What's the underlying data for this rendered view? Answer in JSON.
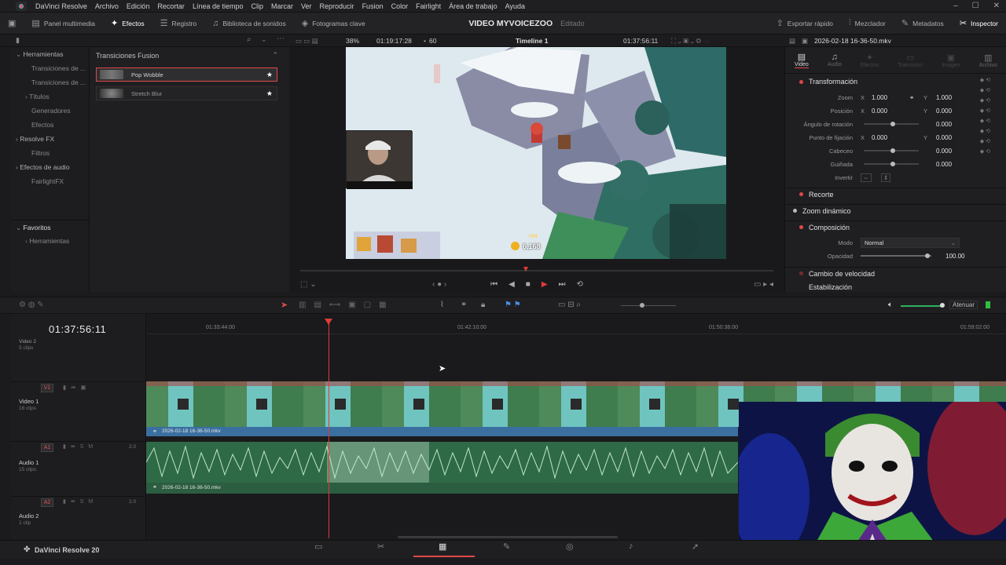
{
  "menu": {
    "app": "DaVinci Resolve",
    "items": [
      "Archivo",
      "Edición",
      "Recortar",
      "Línea de tiempo",
      "Clip",
      "Marcar",
      "Ver",
      "Reproducir",
      "Fusion",
      "Color",
      "Fairlight",
      "Área de trabajo",
      "Ayuda"
    ]
  },
  "toolbar": {
    "left": [
      "Panel multimedia",
      "Efectos",
      "Registro",
      "Biblioteca de sonidos",
      "Fotogramas clave"
    ],
    "project": "VIDEO MYVOICEZOO",
    "status": "Editado",
    "right": [
      "Exportar rápido",
      "Mezclador",
      "Metadatos",
      "Inspector"
    ]
  },
  "viewer": {
    "zoom": "38%",
    "timecode_left": "01:19:17:28",
    "fps_label": "60",
    "timeline_name": "Timeline 1",
    "timecode_right": "01:37:56:11",
    "clip_name": "2026-02-18 16-36-50.mkv",
    "coin_value": "6,168",
    "coin_bonus": "+54"
  },
  "leftnav": {
    "tools": "Herramientas",
    "items": [
      "Transiciones de ...",
      "Transiciones de ...",
      "Títulos",
      "Generadores",
      "Efectos"
    ],
    "resolvefx": "Resolve FX",
    "filtros": "Filtros",
    "audio_fx": "Efectos de audio",
    "fairlight": "FairlightFX",
    "favoritos": "Favoritos",
    "fav_tools": "Herramientas"
  },
  "effects": {
    "title": "Transiciones Fusion",
    "items": [
      {
        "label": "Pop Wobble"
      },
      {
        "label": "Stretch Blur"
      }
    ]
  },
  "inspector": {
    "tabs": [
      "Video",
      "Audio",
      "Efectos",
      "Transición",
      "Imagen",
      "Archivo"
    ],
    "transform": "Transformación",
    "zoom": "Zoom",
    "zoom_x": "1.000",
    "zoom_y": "1.000",
    "position": "Posición",
    "pos_x": "0.000",
    "pos_y": "0.000",
    "rotation": "Ángulo de rotación",
    "rotation_val": "0.000",
    "anchor": "Punto de fijación",
    "anchor_x": "0.000",
    "anchor_y": "0.000",
    "pitch": "Cabeceo",
    "pitch_val": "0.000",
    "yaw": "Guiñada",
    "yaw_val": "0.000",
    "flip": "Invertir",
    "crop": "Recorte",
    "dynzoom": "Zoom dinámico",
    "comp": "Composición",
    "mode": "Modo",
    "mode_val": "Normal",
    "opacity": "Opacidad",
    "opacity_val": "100.00",
    "speed": "Cambio de velocidad",
    "stab": "Estabilización"
  },
  "timeline": {
    "timecode": "01:37:56:11",
    "ruler": [
      "01:33:44:00",
      "01:42:10:00",
      "01:50:36:00",
      "01:59:02:00"
    ],
    "track_top": {
      "label": "Video 2",
      "sub": "5 clips"
    },
    "v1": {
      "badge": "V1",
      "label": "Video 1",
      "sub": "18 clips",
      "clip": "2026-02-18 16-36-50.mkv"
    },
    "a1": {
      "badge": "A1",
      "label": "Audio 1",
      "sub": "15 clips",
      "clip": "2026-02-18 16-36-50.mkv",
      "level": "2.0"
    },
    "a2": {
      "badge": "A2",
      "label": "Audio 2",
      "sub": "1 clip",
      "level": "2.0"
    },
    "atenuar": "Atenuar"
  },
  "bottom": {
    "app_version": "DaVinci Resolve 20"
  },
  "colors": {
    "accent": "#e04848",
    "video_clip": "#3a6fa0",
    "audio_clip": "#2e6a46"
  }
}
